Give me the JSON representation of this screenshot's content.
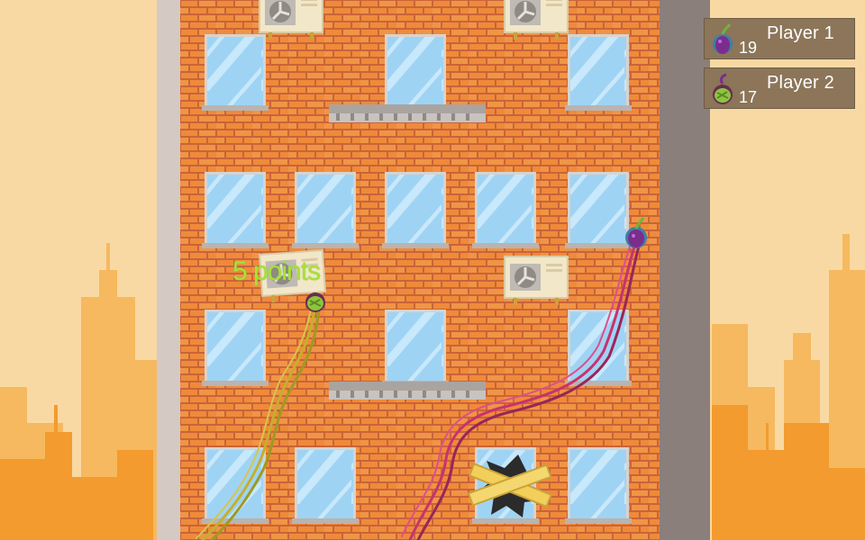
{
  "hud": {
    "players": [
      {
        "name": "Player 1",
        "score": "19",
        "avatar_icon": "purple-eggplant-creature-icon",
        "color": "#7b2d8e"
      },
      {
        "name": "Player 2",
        "score": "17",
        "avatar_icon": "green-melon-creature-icon",
        "color": "#8cc63f"
      }
    ]
  },
  "popup": {
    "text": "5 points"
  },
  "colors": {
    "sky": "#f9d9a3",
    "skyline_far": "#f6b95f",
    "skyline_near": "#f39b2e",
    "brick": "#ef8a3a",
    "mortar": "#c9643a",
    "window_glass": "#9fd3f4",
    "player1_rope": "#c8326f",
    "player2_rope": "#c4b02a"
  }
}
